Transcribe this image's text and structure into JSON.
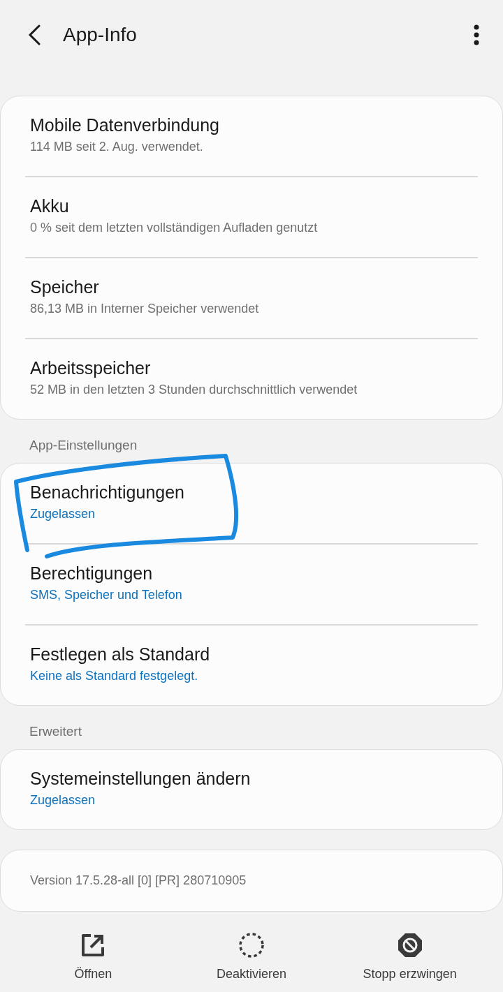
{
  "header": {
    "title": "App-Info"
  },
  "sections": [
    {
      "items": [
        {
          "title": "Mobile Datenverbindung",
          "subtitle": "114 MB seit 2. Aug. verwendet.",
          "kind": "usage",
          "highlighted": false
        },
        {
          "title": "Akku",
          "subtitle": "0 % seit dem letzten vollständigen Aufladen genutzt",
          "kind": "usage",
          "highlighted": false
        },
        {
          "title": "Speicher",
          "subtitle": "86,13 MB in Interner Speicher verwendet",
          "kind": "usage",
          "highlighted": false
        },
        {
          "title": "Arbeitsspeicher",
          "subtitle": "52 MB in den letzten 3 Stunden durchschnittlich verwendet",
          "kind": "usage",
          "highlighted": false
        }
      ]
    },
    {
      "title": "App-Einstellungen",
      "items": [
        {
          "title": "Benachrichtigungen",
          "subtitle": "Zugelassen",
          "kind": "setting",
          "highlighted": true
        },
        {
          "title": "Berechtigungen",
          "subtitle": "SMS, Speicher und Telefon",
          "kind": "setting",
          "highlighted": false
        },
        {
          "title": "Festlegen als Standard",
          "subtitle": "Keine als Standard festgelegt.",
          "kind": "setting",
          "highlighted": false
        }
      ]
    },
    {
      "title": "Erweitert",
      "items": [
        {
          "title": "Systemeinstellungen ändern",
          "subtitle": "Zugelassen",
          "kind": "setting",
          "highlighted": false
        }
      ]
    }
  ],
  "version": "Version 17.5.28-all [0] [PR] 280710905",
  "actions": [
    {
      "label": "Öffnen",
      "kind": "open"
    },
    {
      "label": "Deaktivieren",
      "kind": "disable"
    },
    {
      "label": "Stopp erzwingen",
      "kind": "stop"
    }
  ]
}
